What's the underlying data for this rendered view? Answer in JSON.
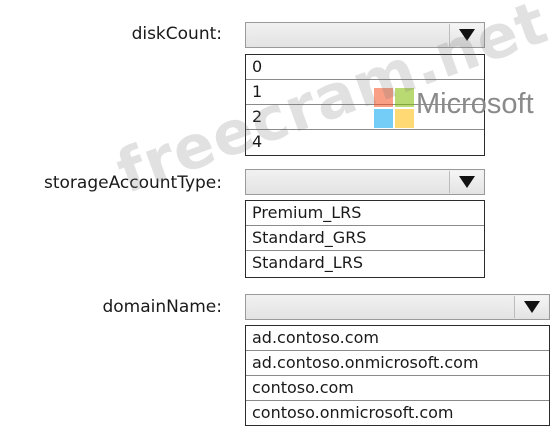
{
  "fields": {
    "diskCount": {
      "label": "diskCount:",
      "options": [
        "0",
        "1",
        "2",
        "4"
      ]
    },
    "storageAccountType": {
      "label": "storageAccountType:",
      "options": [
        "Premium_LRS",
        "Standard_GRS",
        "Standard_LRS"
      ]
    },
    "domainName": {
      "label": "domainName:",
      "options": [
        "ad.contoso.com",
        "ad.contoso.onmicrosoft.com",
        "contoso.com",
        "contoso.onmicrosoft.com"
      ]
    }
  },
  "watermark": {
    "text": "freecram.net"
  },
  "logo": {
    "text": "Microsoft",
    "colors": [
      "#f25022",
      "#7fba00",
      "#00a4ef",
      "#ffb900"
    ]
  },
  "icons": {
    "dropdown": "triangle-down-icon"
  }
}
